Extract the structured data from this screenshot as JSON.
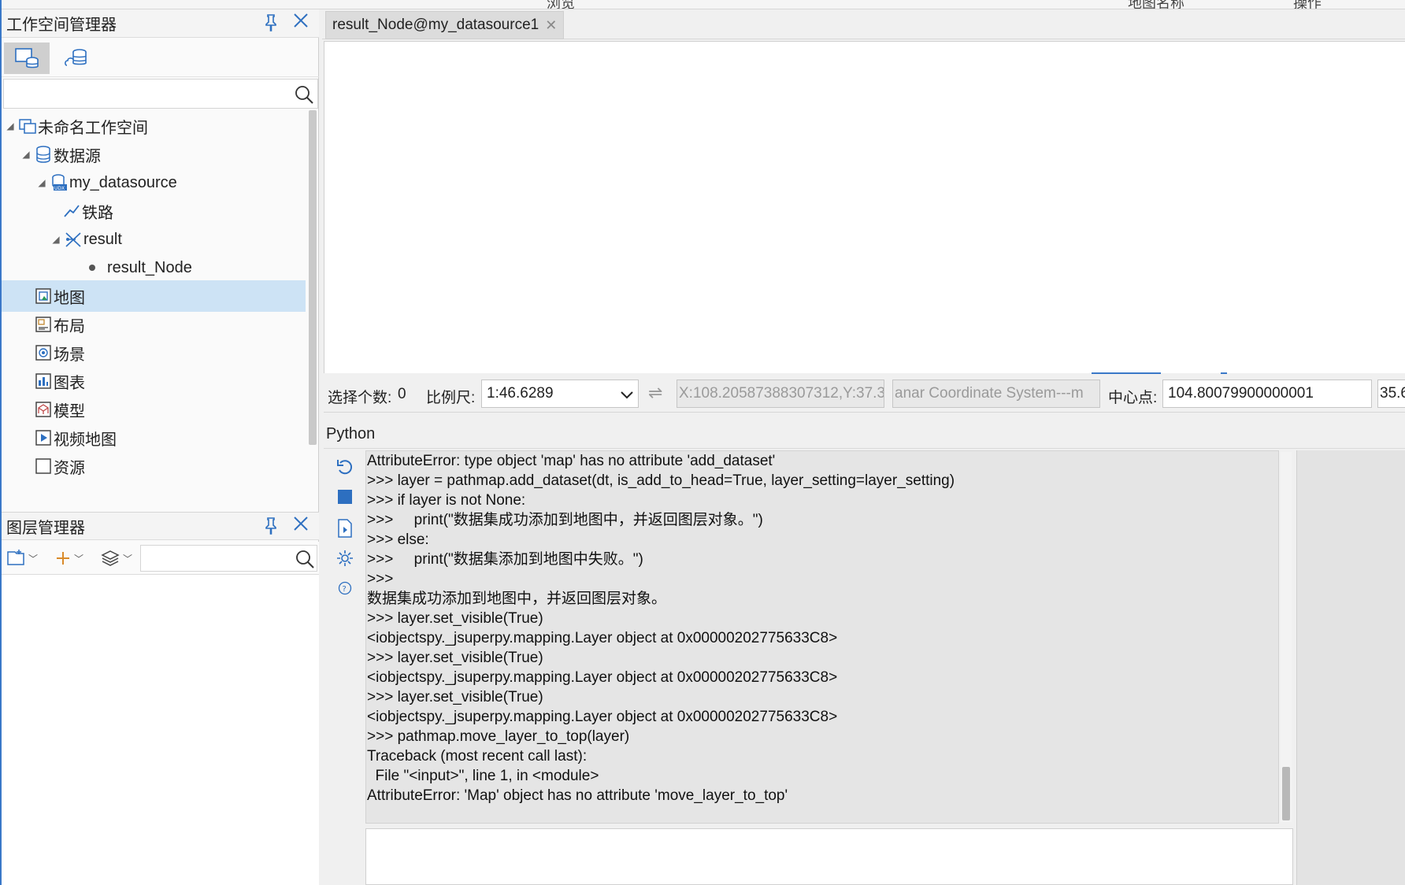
{
  "top_strip": {
    "left_text": "浏览",
    "mid_text": "地图名称",
    "right_text": "操作"
  },
  "workspace_manager": {
    "title": "工作空间管理器",
    "tree": [
      {
        "label": "未命名工作空间",
        "icon": "workspace-icon",
        "level": 0,
        "expanded": true
      },
      {
        "label": "数据源",
        "icon": "datasources-icon",
        "level": 1,
        "expanded": true
      },
      {
        "label": "my_datasource",
        "icon": "udx-datasource-icon",
        "level": 2,
        "expanded": true
      },
      {
        "label": "铁路",
        "icon": "line-dataset-icon",
        "level": 3,
        "expanded": false
      },
      {
        "label": "result",
        "icon": "network-dataset-icon",
        "level": 3,
        "expanded": true
      },
      {
        "label": "result_Node",
        "icon": "point-dataset-icon",
        "level": 4,
        "expanded": false
      },
      {
        "label": "地图",
        "icon": "maps-icon",
        "level": 1,
        "selected": true
      },
      {
        "label": "布局",
        "icon": "layouts-icon",
        "level": 1
      },
      {
        "label": "场景",
        "icon": "scenes-icon",
        "level": 1
      },
      {
        "label": "图表",
        "icon": "charts-icon",
        "level": 1
      },
      {
        "label": "模型",
        "icon": "models-icon",
        "level": 1
      },
      {
        "label": "视频地图",
        "icon": "video-map-icon",
        "level": 1
      },
      {
        "label": "资源",
        "icon": "resources-icon",
        "level": 1
      }
    ]
  },
  "layer_manager": {
    "title": "图层管理器"
  },
  "document_tab": {
    "label": "result_Node@my_datasource1"
  },
  "status_bar": {
    "selection_label": "选择个数:",
    "selection_count": "0",
    "scale_label": "比例尺:",
    "scale_value": "1:46.6289",
    "coordinates": "X:108.20587388307312,Y:37.3",
    "coord_system": "anar Coordinate System---m",
    "center_label": "中心点:",
    "center_x": "104.80079900000001",
    "center_y": "35.6"
  },
  "python": {
    "title": "Python",
    "console_lines": [
      "AttributeError: type object 'map' has no attribute 'add_dataset'",
      ">>> layer = pathmap.add_dataset(dt, is_add_to_head=True, layer_setting=layer_setting)",
      ">>> if layer is not None:",
      ">>>     print(\"数据集成功添加到地图中，并返回图层对象。\")",
      ">>> else:",
      ">>>     print(\"数据集添加到地图中失败。\")",
      ">>>",
      "数据集成功添加到地图中，并返回图层对象。",
      ">>> layer.set_visible(True)",
      "<iobjectspy._jsuperpy.mapping.Layer object at 0x00000202775633C8>",
      ">>> layer.set_visible(True)",
      "<iobjectspy._jsuperpy.mapping.Layer object at 0x00000202775633C8>",
      ">>> layer.set_visible(True)",
      "<iobjectspy._jsuperpy.mapping.Layer object at 0x00000202775633C8>",
      ">>> pathmap.move_layer_to_top(layer)",
      "Traceback (most recent call last):",
      "  File \"<input>\", line 1, in <module>",
      "AttributeError: 'Map' object has no attribute 'move_layer_to_top'"
    ]
  },
  "colors": {
    "accent": "#2d6fc0",
    "selection": "#cde3f5",
    "console_bg": "#e5e5e5"
  }
}
